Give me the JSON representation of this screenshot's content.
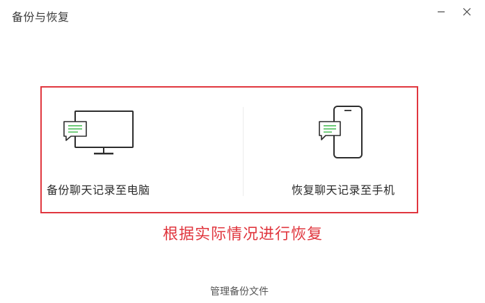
{
  "window": {
    "title": "备份与恢复"
  },
  "options": {
    "backup_label": "备份聊天记录至电脑",
    "restore_label": "恢复聊天记录至手机"
  },
  "annotation": {
    "text": "根据实际情况进行恢复"
  },
  "footer": {
    "manage_link": "管理备份文件"
  },
  "colors": {
    "highlight": "#e0353d",
    "chat_bubble_lines": "#3bb84a"
  },
  "icons": {
    "minimize": "minimize-icon",
    "close": "close-icon",
    "computer": "computer-monitor-icon",
    "phone": "mobile-phone-icon",
    "chat_bubble": "chat-bubble-icon"
  }
}
